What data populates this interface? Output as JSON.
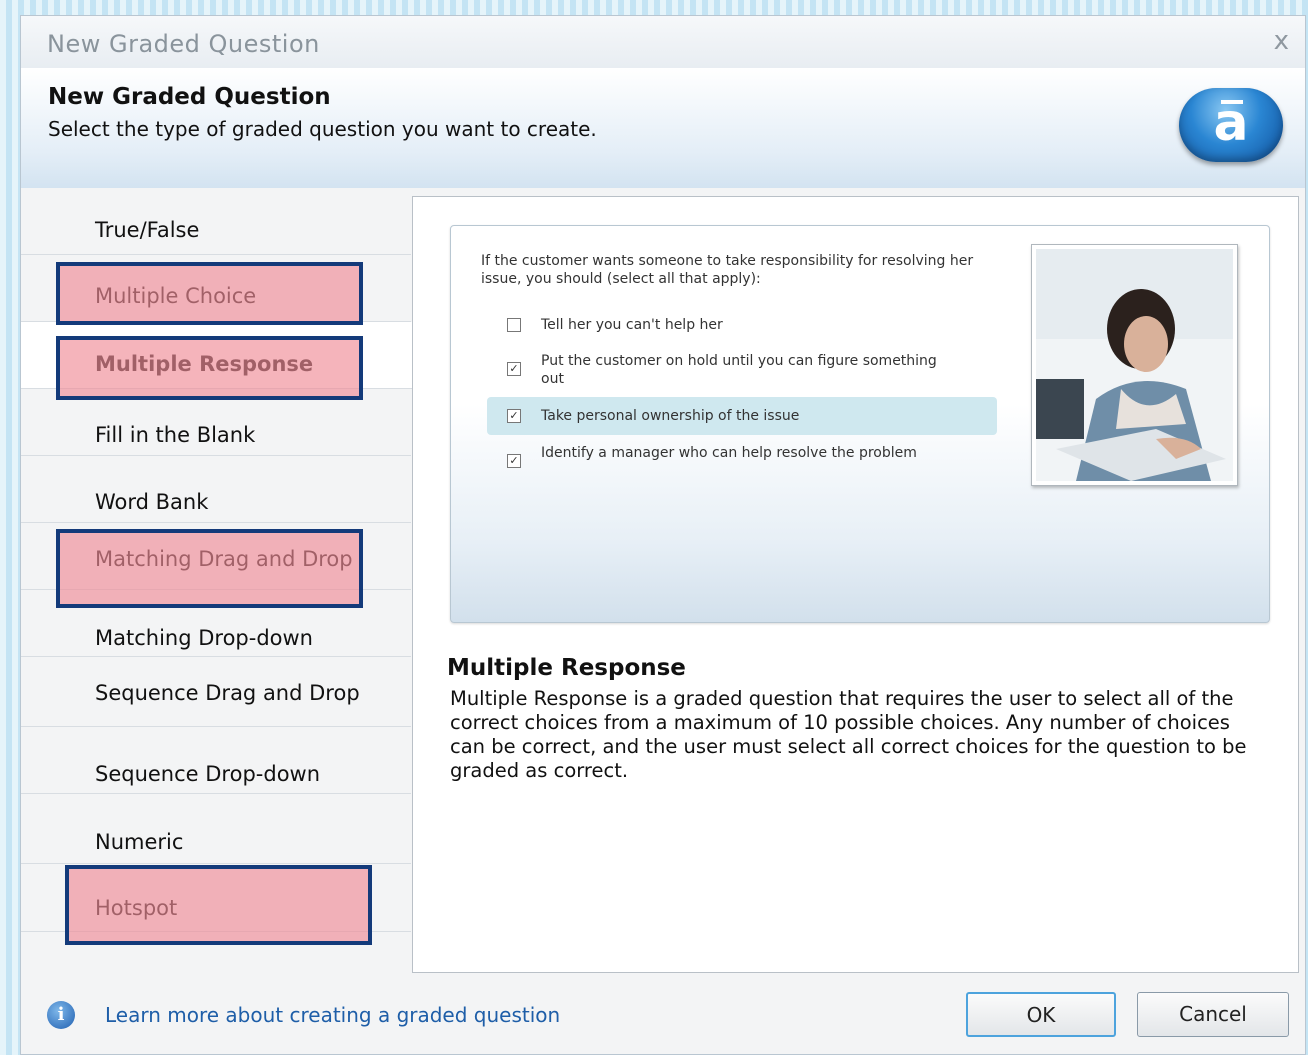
{
  "window": {
    "title": "New Graded Question",
    "close_glyph": "x"
  },
  "header": {
    "title": "New Graded Question",
    "subtitle": "Select the type of graded question you want to create.",
    "logo_letter": "a",
    "logo_icon": "app-logo-icon"
  },
  "sidebar": {
    "items": [
      {
        "label": "True/False"
      },
      {
        "label": "Multiple Choice"
      },
      {
        "label": "Multiple Response"
      },
      {
        "label": "Fill in the Blank"
      },
      {
        "label": "Word Bank"
      },
      {
        "label": "Matching Drag and Drop"
      },
      {
        "label": "Matching Drop-down"
      },
      {
        "label": "Sequence Drag and Drop"
      },
      {
        "label": "Sequence Drop-down"
      },
      {
        "label": "Numeric"
      },
      {
        "label": "Hotspot"
      }
    ],
    "selected": "Multiple Response"
  },
  "preview": {
    "question": "If the customer wants someone to take responsibility for resolving her issue, you should (select all that apply):",
    "options": [
      {
        "text": "Tell her you can't help her",
        "checked": false
      },
      {
        "text": "Put the customer on hold until you can figure something out",
        "checked": true
      },
      {
        "text": "Take personal ownership of the issue",
        "checked": true
      },
      {
        "text": "Identify a manager who can help resolve the problem",
        "checked": true
      }
    ],
    "photo_icon": "call-center-agent-photo"
  },
  "description": {
    "title": "Multiple Response",
    "body": "Multiple Response is a graded question that requires the user to select all of the correct choices from a maximum of 10 possible choices.  Any number of choices can be correct, and the user must select all correct choices for the question to be graded as correct."
  },
  "footer": {
    "info_icon": "info-icon",
    "info_glyph": "i",
    "link_text": "Learn more about creating a graded question",
    "ok_label": "OK",
    "cancel_label": "Cancel"
  },
  "colors": {
    "highlight_fill": "#f08c96",
    "highlight_border": "#133a7a",
    "link": "#1e5ea8"
  }
}
